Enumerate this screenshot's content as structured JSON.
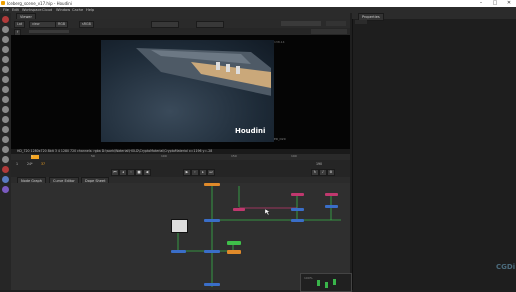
{
  "window": {
    "title": "Iceberg_scene_v17.hip - Houdini",
    "min_icon": "minimize-icon",
    "max_icon": "maximize-icon",
    "close_icon": "close-icon",
    "min_glyph": "–",
    "max_glyph": "□",
    "close_glyph": "✕"
  },
  "menu": [
    "File",
    "Edit",
    "Workspace",
    "Cloud",
    "Window",
    "Cache",
    "Help"
  ],
  "viewer": {
    "tab": "Viewer",
    "controls": [
      "Lat",
      "view",
      "RGB",
      "sRGB"
    ],
    "frame_field": "f",
    "hlogo": "Houdini",
    "corner_label": "ER_D20",
    "top_label": "138.14",
    "info": "HD_720 1280x720  8bit  3 4 1280 720 channels: rgba  D:\\work\\Waterial\\HOLD\\CryptoMaterial\\CryptoMaterial   x=1196 y=-28"
  },
  "timeline": {
    "start": "1",
    "end": "190",
    "current": "37",
    "ticks": [
      "1",
      "50",
      "100",
      "150",
      "190"
    ],
    "fps": "24*"
  },
  "network": {
    "tabs": [
      "Node Graph",
      "Curve Editor",
      "Dope Sheet"
    ],
    "status": "100%"
  },
  "properties": {
    "tab": "Properties"
  },
  "watermark": "CGDi",
  "colors": {
    "accent": "#f5a623",
    "node_pink": "#c0386e",
    "node_blue": "#3a6ec8",
    "node_green": "#3fc04a",
    "node_orange": "#e08a2a",
    "wire_green": "#39b54a"
  }
}
